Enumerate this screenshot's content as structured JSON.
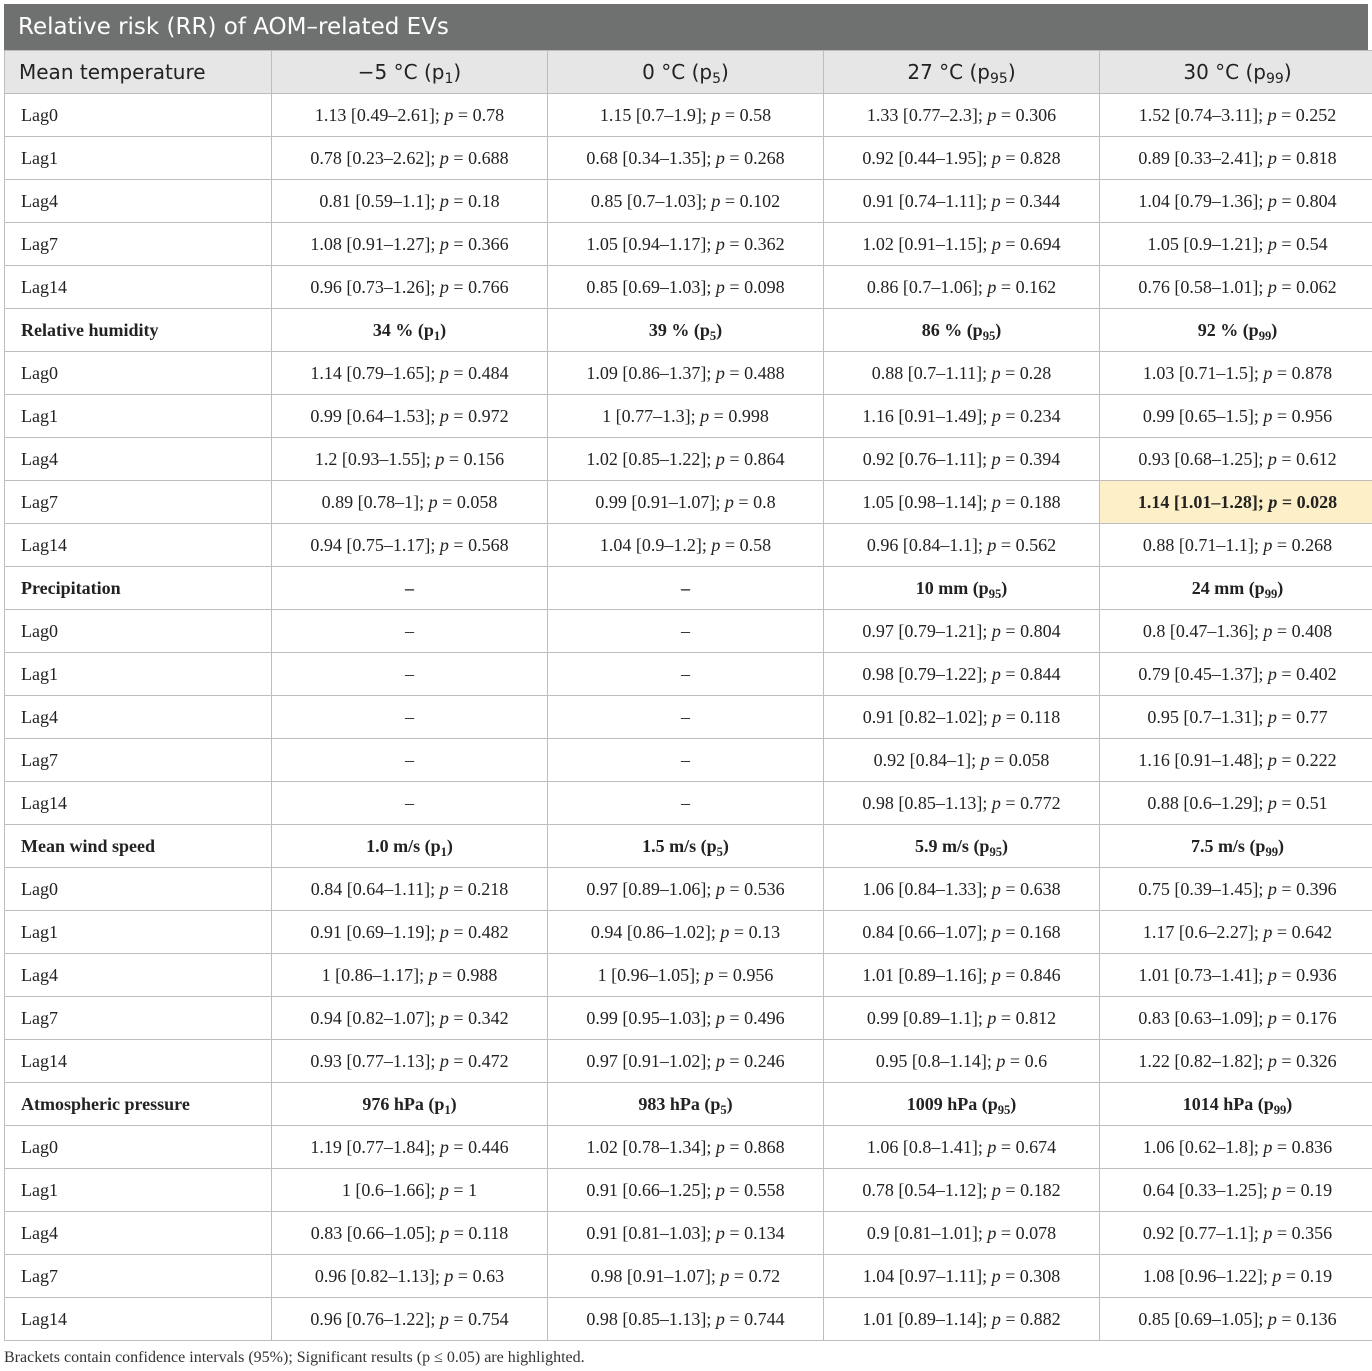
{
  "title": "Relative risk (RR) of AOM–related EVs",
  "columns": [
    {
      "label": "Mean temperature"
    },
    {
      "label": "−5 °C (p",
      "sub": "1",
      "post": ")"
    },
    {
      "label": "0 °C (p",
      "sub": "5",
      "post": ")"
    },
    {
      "label": "27 °C (p",
      "sub": "95",
      "post": ")"
    },
    {
      "label": "30 °C (p",
      "sub": "99",
      "post": ")"
    }
  ],
  "highlight_color": "#fdf0c8",
  "groups": [
    {
      "header": null,
      "rows": [
        {
          "lag": "Lag0",
          "cells": [
            {
              "ci": "1.13 [0.49–2.61]",
              "p": "0.78"
            },
            {
              "ci": "1.15 [0.7–1.9]",
              "p": "0.58"
            },
            {
              "ci": "1.33 [0.77–2.3]",
              "p": "0.306"
            },
            {
              "ci": "1.52 [0.74–3.11]",
              "p": "0.252"
            }
          ]
        },
        {
          "lag": "Lag1",
          "cells": [
            {
              "ci": "0.78 [0.23–2.62]",
              "p": "0.688"
            },
            {
              "ci": "0.68 [0.34–1.35]",
              "p": "0.268"
            },
            {
              "ci": "0.92 [0.44–1.95]",
              "p": "0.828"
            },
            {
              "ci": "0.89 [0.33–2.41]",
              "p": "0.818"
            }
          ]
        },
        {
          "lag": "Lag4",
          "cells": [
            {
              "ci": "0.81 [0.59–1.1]",
              "p": "0.18"
            },
            {
              "ci": "0.85 [0.7–1.03]",
              "p": "0.102"
            },
            {
              "ci": "0.91 [0.74–1.11]",
              "p": "0.344"
            },
            {
              "ci": "1.04 [0.79–1.36]",
              "p": "0.804"
            }
          ]
        },
        {
          "lag": "Lag7",
          "cells": [
            {
              "ci": "1.08 [0.91–1.27]",
              "p": "0.366"
            },
            {
              "ci": "1.05 [0.94–1.17]",
              "p": "0.362"
            },
            {
              "ci": "1.02 [0.91–1.15]",
              "p": "0.694"
            },
            {
              "ci": "1.05 [0.9–1.21]",
              "p": "0.54"
            }
          ]
        },
        {
          "lag": "Lag14",
          "cells": [
            {
              "ci": "0.96 [0.73–1.26]",
              "p": "0.766"
            },
            {
              "ci": "0.85 [0.69–1.03]",
              "p": "0.098"
            },
            {
              "ci": "0.86 [0.7–1.06]",
              "p": "0.162"
            },
            {
              "ci": "0.76 [0.58–1.01]",
              "p": "0.062"
            }
          ]
        }
      ]
    },
    {
      "header": {
        "label": "Relative humidity",
        "cells": [
          {
            "text": "34 % (p",
            "sub": "1",
            "post": ")"
          },
          {
            "text": "39 % (p",
            "sub": "5",
            "post": ")"
          },
          {
            "text": "86 % (p",
            "sub": "95",
            "post": ")"
          },
          {
            "text": "92 % (p",
            "sub": "99",
            "post": ")"
          }
        ]
      },
      "rows": [
        {
          "lag": "Lag0",
          "cells": [
            {
              "ci": "1.14 [0.79–1.65]",
              "p": "0.484"
            },
            {
              "ci": "1.09 [0.86–1.37]",
              "p": "0.488"
            },
            {
              "ci": "0.88 [0.7–1.11]",
              "p": "0.28"
            },
            {
              "ci": "1.03 [0.71–1.5]",
              "p": "0.878"
            }
          ]
        },
        {
          "lag": "Lag1",
          "cells": [
            {
              "ci": "0.99 [0.64–1.53]",
              "p": "0.972"
            },
            {
              "ci": "1 [0.77–1.3]",
              "p": "0.998"
            },
            {
              "ci": "1.16 [0.91–1.49]",
              "p": "0.234"
            },
            {
              "ci": "0.99 [0.65–1.5]",
              "p": "0.956"
            }
          ]
        },
        {
          "lag": "Lag4",
          "cells": [
            {
              "ci": "1.2 [0.93–1.55]",
              "p": "0.156"
            },
            {
              "ci": "1.02 [0.85–1.22]",
              "p": "0.864"
            },
            {
              "ci": "0.92 [0.76–1.11]",
              "p": "0.394"
            },
            {
              "ci": "0.93 [0.68–1.25]",
              "p": "0.612"
            }
          ]
        },
        {
          "lag": "Lag7",
          "cells": [
            {
              "ci": "0.89 [0.78–1]",
              "p": "0.058"
            },
            {
              "ci": "0.99 [0.91–1.07]",
              "p": "0.8"
            },
            {
              "ci": "1.05 [0.98–1.14]",
              "p": "0.188"
            },
            {
              "ci": "1.14 [1.01–1.28]",
              "p": "0.028",
              "highlight": true
            }
          ]
        },
        {
          "lag": "Lag14",
          "cells": [
            {
              "ci": "0.94 [0.75–1.17]",
              "p": "0.568"
            },
            {
              "ci": "1.04 [0.9–1.2]",
              "p": "0.58"
            },
            {
              "ci": "0.96 [0.84–1.1]",
              "p": "0.562"
            },
            {
              "ci": "0.88 [0.71–1.1]",
              "p": "0.268"
            }
          ]
        }
      ]
    },
    {
      "header": {
        "label": "Precipitation",
        "cells": [
          {
            "text": "–"
          },
          {
            "text": "–"
          },
          {
            "text": "10 mm (p",
            "sub": "95",
            "post": ")"
          },
          {
            "text": "24 mm (p",
            "sub": "99",
            "post": ")"
          }
        ]
      },
      "rows": [
        {
          "lag": "Lag0",
          "cells": [
            {
              "dash": "–"
            },
            {
              "dash": "–"
            },
            {
              "ci": "0.97 [0.79–1.21]",
              "p": "0.804"
            },
            {
              "ci": "0.8 [0.47–1.36]",
              "p": "0.408"
            }
          ]
        },
        {
          "lag": "Lag1",
          "cells": [
            {
              "dash": "–"
            },
            {
              "dash": "–"
            },
            {
              "ci": "0.98 [0.79–1.22]",
              "p": "0.844"
            },
            {
              "ci": "0.79 [0.45–1.37]",
              "p": "0.402"
            }
          ]
        },
        {
          "lag": "Lag4",
          "cells": [
            {
              "dash": "–"
            },
            {
              "dash": "–"
            },
            {
              "ci": "0.91 [0.82–1.02]",
              "p": "0.118"
            },
            {
              "ci": "0.95 [0.7–1.31]",
              "p": "0.77"
            }
          ]
        },
        {
          "lag": "Lag7",
          "cells": [
            {
              "dash": "–"
            },
            {
              "dash": "–"
            },
            {
              "ci": "0.92 [0.84–1]",
              "p": "0.058"
            },
            {
              "ci": "1.16 [0.91–1.48]",
              "p": "0.222"
            }
          ]
        },
        {
          "lag": "Lag14",
          "cells": [
            {
              "dash": "–"
            },
            {
              "dash": "–"
            },
            {
              "ci": "0.98 [0.85–1.13]",
              "p": "0.772"
            },
            {
              "ci": "0.88 [0.6–1.29]",
              "p": "0.51"
            }
          ]
        }
      ]
    },
    {
      "header": {
        "label": "Mean wind speed",
        "cells": [
          {
            "text": "1.0 m/s (p",
            "sub": "1",
            "post": ")"
          },
          {
            "text": "1.5 m/s (p",
            "sub": "5",
            "post": ")"
          },
          {
            "text": "5.9 m/s (p",
            "sub": "95",
            "post": ")"
          },
          {
            "text": "7.5 m/s (p",
            "sub": "99",
            "post": ")"
          }
        ]
      },
      "rows": [
        {
          "lag": "Lag0",
          "cells": [
            {
              "ci": "0.84 [0.64–1.11]",
              "p": "0.218"
            },
            {
              "ci": "0.97 [0.89–1.06]",
              "p": "0.536"
            },
            {
              "ci": "1.06 [0.84–1.33]",
              "p": "0.638"
            },
            {
              "ci": "0.75 [0.39–1.45]",
              "p": "0.396"
            }
          ]
        },
        {
          "lag": "Lag1",
          "cells": [
            {
              "ci": "0.91 [0.69–1.19]",
              "p": "0.482"
            },
            {
              "ci": "0.94 [0.86–1.02]",
              "p": "0.13"
            },
            {
              "ci": "0.84 [0.66–1.07]",
              "p": "0.168"
            },
            {
              "ci": "1.17 [0.6–2.27]",
              "p": "0.642"
            }
          ]
        },
        {
          "lag": "Lag4",
          "cells": [
            {
              "ci": "1 [0.86–1.17]",
              "p": "0.988"
            },
            {
              "ci": "1 [0.96–1.05]",
              "p": "0.956"
            },
            {
              "ci": "1.01 [0.89–1.16]",
              "p": "0.846"
            },
            {
              "ci": "1.01 [0.73–1.41]",
              "p": "0.936"
            }
          ]
        },
        {
          "lag": "Lag7",
          "cells": [
            {
              "ci": "0.94 [0.82–1.07]",
              "p": "0.342"
            },
            {
              "ci": "0.99 [0.95–1.03]",
              "p": "0.496"
            },
            {
              "ci": "0.99 [0.89–1.1]",
              "p": "0.812"
            },
            {
              "ci": "0.83 [0.63–1.09]",
              "p": "0.176"
            }
          ]
        },
        {
          "lag": "Lag14",
          "cells": [
            {
              "ci": "0.93 [0.77–1.13]",
              "p": "0.472"
            },
            {
              "ci": "0.97 [0.91–1.02]",
              "p": "0.246"
            },
            {
              "ci": "0.95 [0.8–1.14]",
              "p": "0.6"
            },
            {
              "ci": "1.22 [0.82–1.82]",
              "p": "0.326"
            }
          ]
        }
      ]
    },
    {
      "header": {
        "label": "Atmospheric pressure",
        "cells": [
          {
            "text": "976 hPa (p",
            "sub": "1",
            "post": ")"
          },
          {
            "text": "983 hPa (p",
            "sub": "5",
            "post": ")"
          },
          {
            "text": "1009 hPa (p",
            "sub": "95",
            "post": ")"
          },
          {
            "text": "1014 hPa (p",
            "sub": "99",
            "post": ")"
          }
        ]
      },
      "rows": [
        {
          "lag": "Lag0",
          "cells": [
            {
              "ci": "1.19 [0.77–1.84]",
              "p": "0.446"
            },
            {
              "ci": "1.02 [0.78–1.34]",
              "p": "0.868"
            },
            {
              "ci": "1.06 [0.8–1.41]",
              "p": "0.674"
            },
            {
              "ci": "1.06 [0.62–1.8]",
              "p": "0.836"
            }
          ]
        },
        {
          "lag": "Lag1",
          "cells": [
            {
              "ci": "1 [0.6–1.66]",
              "p": "1"
            },
            {
              "ci": "0.91 [0.66–1.25]",
              "p": "0.558"
            },
            {
              "ci": "0.78 [0.54–1.12]",
              "p": "0.182"
            },
            {
              "ci": "0.64 [0.33–1.25]",
              "p": "0.19"
            }
          ]
        },
        {
          "lag": "Lag4",
          "cells": [
            {
              "ci": "0.83 [0.66–1.05]",
              "p": "0.118"
            },
            {
              "ci": "0.91 [0.81–1.03]",
              "p": "0.134"
            },
            {
              "ci": "0.9 [0.81–1.01]",
              "p": "0.078"
            },
            {
              "ci": "0.92 [0.77–1.1]",
              "p": "0.356"
            }
          ]
        },
        {
          "lag": "Lag7",
          "cells": [
            {
              "ci": "0.96 [0.82–1.13]",
              "p": "0.63"
            },
            {
              "ci": "0.98 [0.91–1.07]",
              "p": "0.72"
            },
            {
              "ci": "1.04 [0.97–1.11]",
              "p": "0.308"
            },
            {
              "ci": "1.08 [0.96–1.22]",
              "p": "0.19"
            }
          ]
        },
        {
          "lag": "Lag14",
          "cells": [
            {
              "ci": "0.96 [0.76–1.22]",
              "p": "0.754"
            },
            {
              "ci": "0.98 [0.85–1.13]",
              "p": "0.744"
            },
            {
              "ci": "1.01 [0.89–1.14]",
              "p": "0.882"
            },
            {
              "ci": "0.85 [0.69–1.05]",
              "p": "0.136"
            }
          ]
        }
      ]
    }
  ],
  "footnote": "Brackets contain confidence intervals (95%); Significant results (p ≤ 0.05) are highlighted."
}
